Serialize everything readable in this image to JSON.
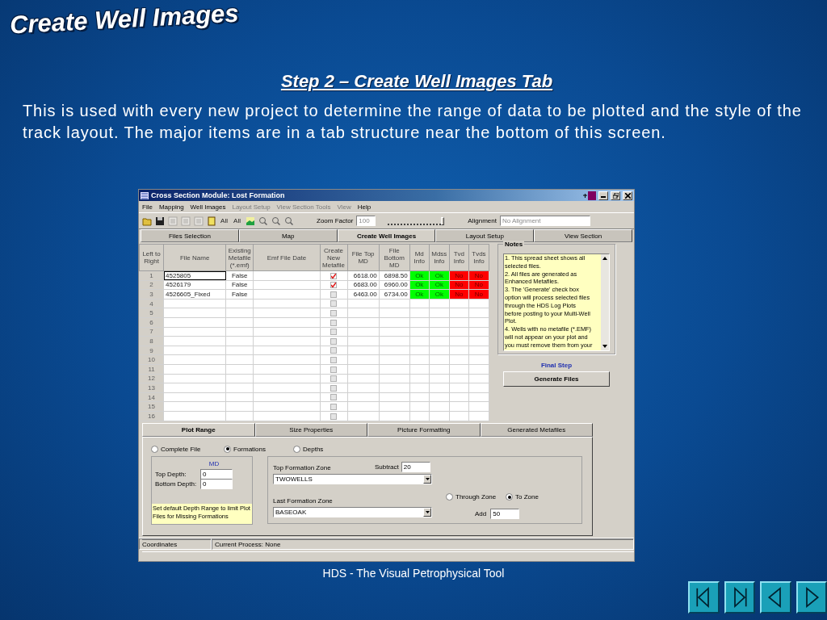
{
  "slide": {
    "title": "Create Well Images",
    "subtitle": "Step 2 – Create Well Images Tab",
    "paragraph": "This is used with every new project to determine the range of data to be plotted and the style of the track layout.  The major items are in a tab structure near the bottom of this screen.",
    "footer": "HDS - The Visual Petrophysical Tool",
    "nav_buttons": [
      {
        "kind": "first"
      },
      {
        "kind": "last"
      },
      {
        "kind": "previous"
      },
      {
        "kind": "next"
      }
    ]
  },
  "window": {
    "title": "Cross Section Module: Lost Formation",
    "menu": [
      {
        "label": "File",
        "disabled": false
      },
      {
        "label": "Mapping",
        "disabled": false
      },
      {
        "label": "Well Images",
        "disabled": false
      },
      {
        "label": "Layout Setup",
        "disabled": true
      },
      {
        "label": "View Section Tools",
        "disabled": true
      },
      {
        "label": "View",
        "disabled": true
      },
      {
        "label": "Help",
        "disabled": false
      }
    ],
    "toolbar": [
      {
        "kind": "open",
        "disabled": false
      },
      {
        "kind": "save",
        "disabled": false
      },
      {
        "kind": "list",
        "disabled": true
      },
      {
        "kind": "list",
        "disabled": true
      },
      {
        "kind": "list",
        "disabled": true
      },
      {
        "kind": "document",
        "disabled": false
      },
      {
        "kind": "check-all",
        "label": "All",
        "disabled": false
      },
      {
        "kind": "check-all",
        "label": "All",
        "disabled": false
      },
      {
        "kind": "image",
        "disabled": false
      },
      {
        "kind": "zoom",
        "disabled": false
      },
      {
        "kind": "zoom",
        "disabled": false
      },
      {
        "kind": "zoom",
        "disabled": false
      }
    ],
    "zoom_factor": {
      "label": "Zoom Factor",
      "value": "100",
      "disabled": true,
      "level": 1
    },
    "alignment": {
      "label": "Alignment",
      "value": "No Alignment",
      "disabled": true
    },
    "tabs": [
      {
        "label": "Files Selection",
        "selected": false
      },
      {
        "label": "Map",
        "selected": false
      },
      {
        "label": "Create Well Images",
        "selected": true
      },
      {
        "label": "Layout Setup",
        "selected": false
      },
      {
        "label": "View Section",
        "selected": false
      }
    ],
    "grid": {
      "columns": [
        "Left to Right",
        "File Name",
        "Existing Metafile (*.emf)",
        "Emf File Date",
        "Create New Metafile",
        "File Top MD",
        "File Bottom MD",
        "Md Info",
        "Mdss Info",
        "Tvd Info",
        "Tvds Info"
      ],
      "rows": [
        {
          "row": "1",
          "file_name": "4525805",
          "focused": true,
          "existing": "False",
          "create_new": true,
          "top_md": "6618.00",
          "bottom_md": "6898.50",
          "info": [
            {
              "text": "Ok",
              "color": "#00ff00"
            },
            {
              "text": "Ok",
              "color": "#00ff00"
            },
            {
              "text": "No",
              "color": "#ff0000"
            },
            {
              "text": "No",
              "color": "#ff0000"
            }
          ]
        },
        {
          "row": "2",
          "file_name": "4526179",
          "focused": false,
          "existing": "False",
          "create_new": true,
          "top_md": "6683.00",
          "bottom_md": "6960.00",
          "info": [
            {
              "text": "Ok",
              "color": "#00ff00"
            },
            {
              "text": "Ok",
              "color": "#00ff00"
            },
            {
              "text": "No",
              "color": "#ff0000"
            },
            {
              "text": "No",
              "color": "#ff0000"
            }
          ]
        },
        {
          "row": "3",
          "file_name": "4526605_Fixed",
          "focused": false,
          "existing": "False",
          "create_new": false,
          "top_md": "6463.00",
          "bottom_md": "6734.00",
          "info": [
            {
              "text": "Ok",
              "color": "#00ff00"
            },
            {
              "text": "Ok",
              "color": "#00ff00"
            },
            {
              "text": "No",
              "color": "#ff0000"
            },
            {
              "text": "No",
              "color": "#ff0000"
            }
          ]
        },
        {
          "row": "4",
          "create_new": false
        },
        {
          "row": "5",
          "create_new": false
        },
        {
          "row": "6",
          "create_new": false
        },
        {
          "row": "7",
          "create_new": false
        },
        {
          "row": "8",
          "create_new": false
        },
        {
          "row": "9",
          "create_new": false
        },
        {
          "row": "10",
          "create_new": false
        },
        {
          "row": "11",
          "create_new": false
        },
        {
          "row": "12",
          "create_new": false
        },
        {
          "row": "13",
          "create_new": false
        },
        {
          "row": "14",
          "create_new": false
        },
        {
          "row": "15",
          "create_new": false
        },
        {
          "row": "16",
          "create_new": false
        }
      ]
    },
    "notes": {
      "title": "Notes",
      "lines": [
        "1.  This spread sheet shows all",
        "selected files.",
        "2.  All files are generated as",
        "Enhanced Metafiles.",
        "3.  The 'Generate' check box",
        "option will process selected files",
        "through the HDS Log Plots",
        "before posting to your Multi-Well",
        "Plot.",
        "4.  Wells with no metafile (*.EMF)",
        "will not appear on your plot and",
        "you must remove them from your"
      ]
    },
    "final_step": "Final Step",
    "generate_button": "Generate Files",
    "sub_tabs": [
      {
        "label": "Plot Range",
        "selected": true
      },
      {
        "label": "Size Properties",
        "selected": false
      },
      {
        "label": "Picture Formatting",
        "selected": false
      },
      {
        "label": "Generated Metafiles",
        "selected": false
      }
    ],
    "range_options": [
      {
        "label": "Complete File",
        "selected": false
      },
      {
        "label": "Formations",
        "selected": true
      },
      {
        "label": "Depths",
        "selected": false
      }
    ],
    "md_group": {
      "heading": "MD",
      "top_depth": {
        "label": "Top Depth:",
        "value": "0"
      },
      "bottom_depth": {
        "label": "Bottom Depth:",
        "value": "0"
      },
      "hint": "Set default Depth Range to limit Plot Files for Missing Formations"
    },
    "formation_group": {
      "top_zone": {
        "label": "Top Formation Zone",
        "value": "TWOWELLS"
      },
      "subtract": {
        "label": "Subtract",
        "value": "20"
      },
      "last_zone": {
        "label": "Last Formation Zone",
        "value": "BASEOAK"
      },
      "zone_options": [
        {
          "label": "Through Zone",
          "selected": false
        },
        {
          "label": "To Zone",
          "selected": true
        }
      ],
      "add": {
        "label": "Add",
        "value": "50"
      }
    },
    "status_bar": [
      "Coordinates",
      "Current Process: None"
    ]
  }
}
